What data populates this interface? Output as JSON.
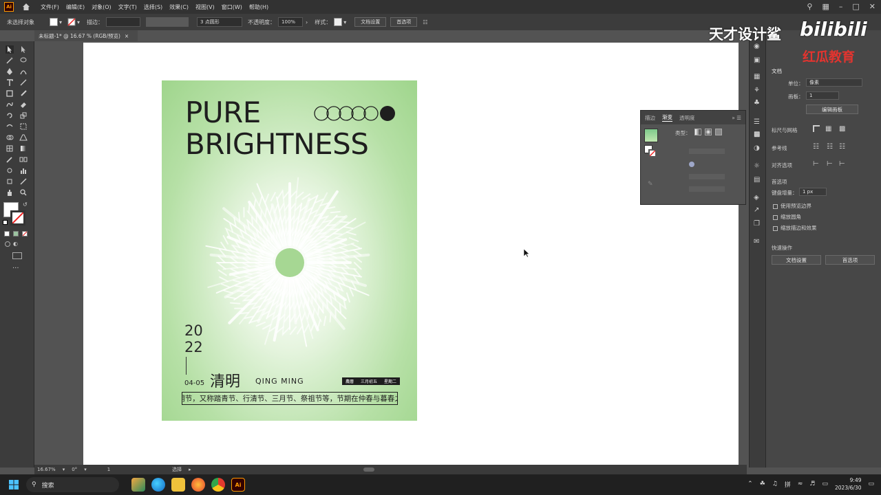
{
  "menubar": {
    "app_logo": "Ai",
    "items": [
      "文件(F)",
      "编辑(E)",
      "对象(O)",
      "文字(T)",
      "选择(S)",
      "效果(C)",
      "视图(V)",
      "窗口(W)",
      "帮助(H)"
    ]
  },
  "controlbar": {
    "selection": "未选择对象",
    "stroke_label": "描边：",
    "brush": "3 点圆形",
    "opacity_label": "不透明度：",
    "opacity_value": "100%",
    "style_label": "样式：",
    "doc_setup": "文档设置",
    "preferences": "首选项"
  },
  "document_tab": {
    "title": "未标题-1* @ 16.67 % (RGB/预览)",
    "close": "×"
  },
  "poster": {
    "title_line1": "PURE",
    "title_line2": "BRIGHTNESS",
    "year_top": "20",
    "year_bottom": "22",
    "date": "04-05",
    "name_cn": "清明",
    "name_en": "QING MING",
    "tags": [
      "農曆",
      "三月初五",
      "星期二"
    ],
    "description": "清明节，又称踏青节、行清节、三月节、祭祖节等，节期在仲春与暮春之交"
  },
  "gradient_panel": {
    "tabs": [
      "描边",
      "渐变",
      "透明度"
    ],
    "type_label": "类型："
  },
  "watermark": {
    "text1": "天才设计鲨",
    "text2": "bilibili",
    "text3": "红瓜教育"
  },
  "properties": {
    "section_doc": "文档",
    "unit_label": "单位：",
    "unit_value": "像素",
    "artboard_label": "画板：",
    "artboard_value": "1",
    "edit_artboard": "编辑画板",
    "rulers_grids": "标尺与网格",
    "guides": "参考线",
    "align_options": "对齐选项",
    "preferences_title": "首选项",
    "keyboard_increment_label": "键盘增量：",
    "keyboard_increment_value": "1 px",
    "checkbox_preview_bounds": "使用预览边界",
    "checkbox_scale_corners": "缩放圆角",
    "checkbox_scale_strokes": "缩放描边和效果",
    "quick_actions": "快速操作",
    "btn_doc_setup": "文档设置",
    "btn_preferences": "首选项"
  },
  "statusbar": {
    "zoom": "16.67%",
    "rotation": "0°",
    "artboard": "1",
    "tool": "选择"
  },
  "taskbar": {
    "search_placeholder": "搜索",
    "ime": "拼",
    "time": "9:49",
    "date": "2023/6/30"
  }
}
